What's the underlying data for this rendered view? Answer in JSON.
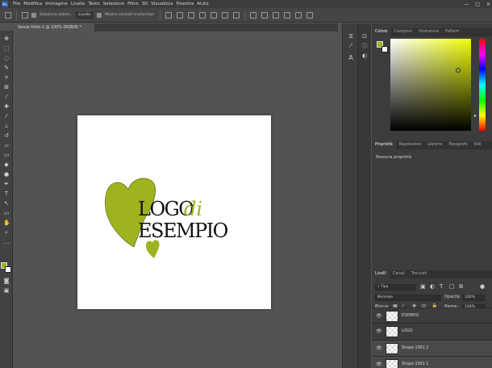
{
  "menubar": {
    "app_logo": "Ps",
    "items": [
      "File",
      "Modifica",
      "Immagine",
      "Livello",
      "Testo",
      "Selezione",
      "Filtro",
      "3D",
      "Visualizza",
      "Finestra",
      "Aiuto"
    ],
    "window_controls": [
      "—",
      "□",
      "✕"
    ]
  },
  "options_bar": {
    "autoselect_label": "Seleziona autom.:",
    "autoselect_value": "Livello",
    "transform_label": "Mostra controlli trasformaz."
  },
  "document": {
    "tab_title": "Senza titolo-1 @ 100% (RGB/8) *"
  },
  "canvas": {
    "logo_line1_part1": "LOGO",
    "logo_line1_part2": "di",
    "logo_line2": "ESEMPIO",
    "accent_color": "#9fb31f"
  },
  "color_panel": {
    "tabs": [
      "Colore",
      "Campioni",
      "Sfumature",
      "Pattern"
    ],
    "active_tab": "Colore",
    "foreground": "#a0b420",
    "background": "#ffffff"
  },
  "properties_panel": {
    "tabs": [
      "Proprietà",
      "Regolazioni",
      "Librerie",
      "Paragrafo",
      "Stili"
    ],
    "active_tab": "Proprietà",
    "message": "Nessuna proprietà"
  },
  "layers_panel": {
    "tabs": [
      "Livelli",
      "Canali",
      "Tracciati"
    ],
    "active_tab": "Livelli",
    "filter_label": "Tipo",
    "blend_mode": "Normale",
    "opacity_label": "Opacità:",
    "opacity_value": "100%",
    "lock_label": "Blocca:",
    "fill_label": "Riemp.:",
    "fill_value": "100%",
    "layers": [
      {
        "name": "ESEMPIO",
        "selected": false
      },
      {
        "name": "LOGO",
        "selected": false
      },
      {
        "name": "Shape 1561 2",
        "selected": true
      },
      {
        "name": "Shape 1561 1",
        "selected": true
      }
    ]
  }
}
